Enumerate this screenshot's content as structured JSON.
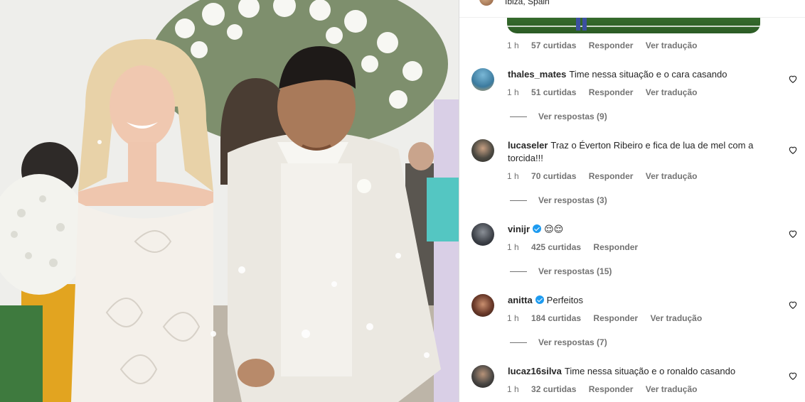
{
  "post": {
    "location": "Ibiza, Spain",
    "prev_comment_meta": {
      "time": "1 h",
      "likes": "57 curtidas",
      "reply": "Responder",
      "translate": "Ver tradução"
    }
  },
  "comments": [
    {
      "username": "thales_mates",
      "text": "Time nessa situação e o cara casando",
      "verified": false,
      "time": "1 h",
      "likes": "51 curtidas",
      "reply": "Responder",
      "translate": "Ver tradução",
      "view_replies": "Ver respostas (9)"
    },
    {
      "username": "lucaseler",
      "text": "Traz o Éverton Ribeiro e fica de lua de mel com a torcida!!!",
      "verified": false,
      "time": "1 h",
      "likes": "70 curtidas",
      "reply": "Responder",
      "translate": "Ver tradução",
      "view_replies": "Ver respostas (3)"
    },
    {
      "username": "vinijr",
      "text": "😌😌",
      "verified": true,
      "time": "1 h",
      "likes": "425 curtidas",
      "reply": "Responder",
      "translate": "",
      "view_replies": "Ver respostas (15)"
    },
    {
      "username": "anitta",
      "text": "Perfeitos",
      "verified": true,
      "time": "1 h",
      "likes": "184 curtidas",
      "reply": "Responder",
      "translate": "Ver tradução",
      "view_replies": "Ver respostas (7)"
    },
    {
      "username": "lucaz16silva",
      "text": "Time nessa situação e o ronaldo casando",
      "verified": false,
      "time": "1 h",
      "likes": "32 curtidas",
      "reply": "Responder",
      "translate": "Ver tradução",
      "view_replies": ""
    }
  ],
  "icons": {
    "like": "heart-outline-icon",
    "verified": "verified-badge-icon"
  },
  "colors": {
    "verified": "#1d9bf0",
    "meta_text": "#737373",
    "text": "#262626"
  }
}
